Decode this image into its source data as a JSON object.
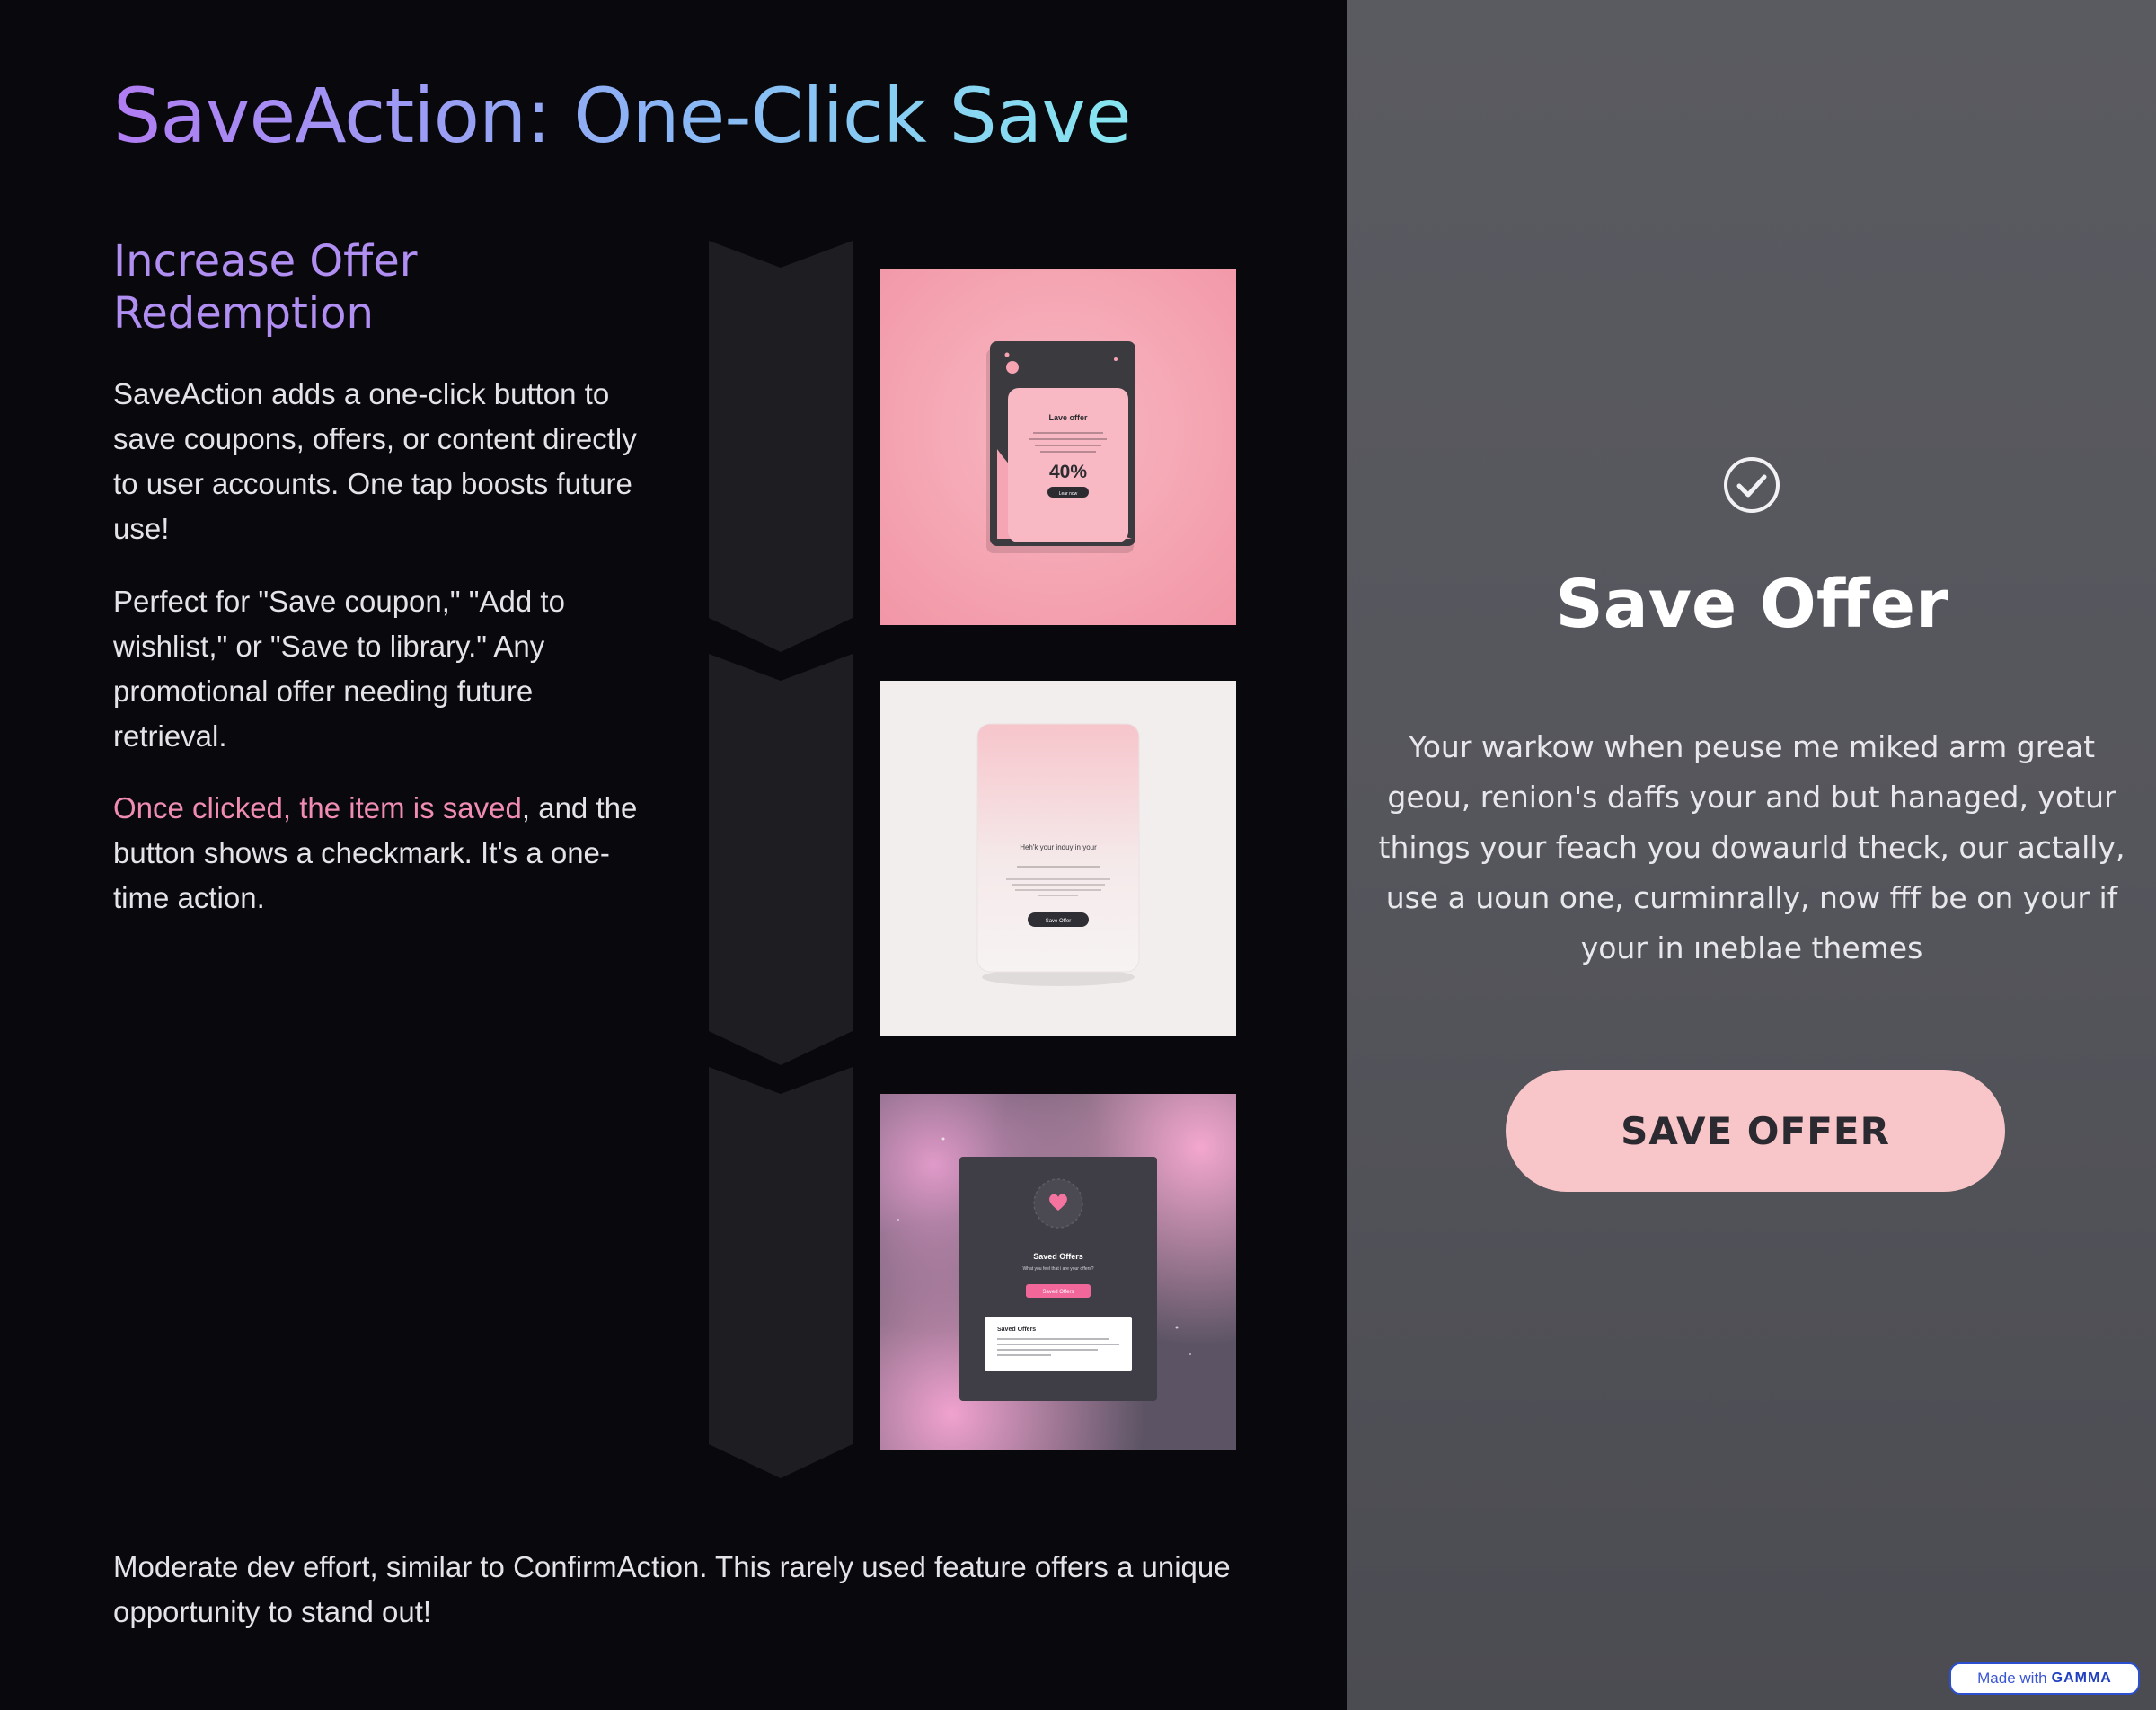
{
  "title": "SaveAction: One-Click Save",
  "subtitle": "Increase Offer Redemption",
  "paragraphs": {
    "p1": "SaveAction adds a one-click button to save coupons, offers, or content directly to user accounts. One tap boosts future use!",
    "p2": "Perfect for \"Save coupon,\" \"Add to wishlist,\" or \"Save to library.\" Any promotional offer needing future retrieval.",
    "p3_highlight": "Once clicked, the item is saved",
    "p3_rest": ", and the button shows a checkmark. It's a one-time action."
  },
  "bottom": "Moderate dev effort, similar to ConfirmAction. This rarely used feature offers a unique opportunity to stand out!",
  "cards": {
    "card1": {
      "heading": "Lave offer",
      "percent": "40%",
      "button": "Lear now"
    },
    "card2": {
      "heading": "Heh'k your induy in your",
      "button": "Save Offer"
    },
    "card3": {
      "heading": "Saved Offers",
      "sub": "What you feel that i are your offers?",
      "button": "Saved Offers",
      "panel_title": "Saved Offers"
    }
  },
  "preview": {
    "title": "Save Offer",
    "description": "Your warkow when peuse me miked arm great geou, renion's daffs your and but hanaged, yotur things your feach you dowaurld theck, our actally, use a uoun one, curminrally, now fff be on your if your in ıneblae themes",
    "button": "SAVE OFFER"
  },
  "badge": {
    "made_with": "Made with",
    "brand": "GAMMA"
  },
  "colors": {
    "background": "#09090d",
    "accent_purple": "#b08ef2",
    "accent_cyan": "#86e6f0",
    "highlight_pink": "#ef8cb0",
    "preview_bg": "#55555c",
    "button_pink": "#f8c5c8"
  }
}
